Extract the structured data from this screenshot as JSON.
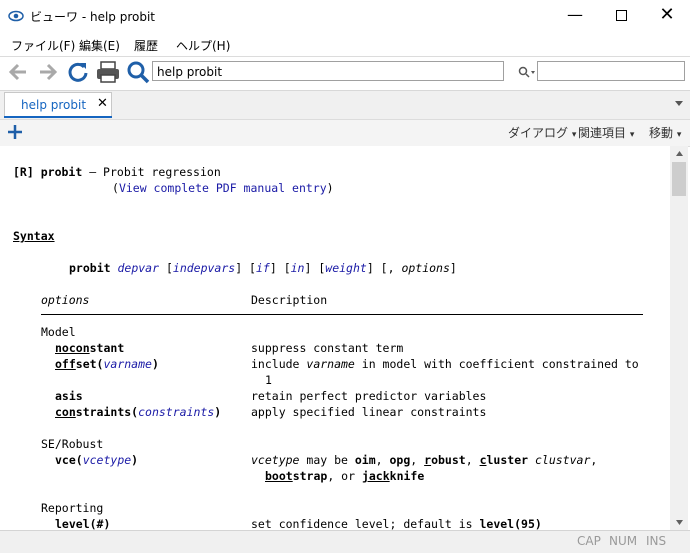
{
  "window": {
    "title": "ビューワ - help probit"
  },
  "menu": {
    "file": "ファイル(F)",
    "edit": "編集(E)",
    "history": "履歴",
    "help": "ヘルプ(H)"
  },
  "toolbar": {
    "address": "help probit",
    "find_placeholder": ""
  },
  "tab": {
    "label": "help probit"
  },
  "subtoolbar": {
    "dialog": "ダイアログ",
    "related": "関連項目",
    "jump": "移動"
  },
  "status": {
    "cap": "CAP",
    "num": "NUM",
    "ins": "INS"
  },
  "help": {
    "ref": "[R]",
    "cmd": "probit",
    "dash": " — ",
    "desc": "Probit regression",
    "pdf_link": "View complete PDF manual entry",
    "syntax_heading": "Syntax",
    "syntax": {
      "cmd": "probit",
      "depvar": "depvar",
      "indepvars": "indepvars",
      "if": "if",
      "in": "in",
      "weight": "weight",
      "options": "options"
    },
    "col_options": "options",
    "col_desc": "Description",
    "groups": {
      "model": "Model",
      "serobust": "SE/Robust",
      "reporting": "Reporting"
    },
    "opts": {
      "noconstant_u": "nocon",
      "noconstant_r": "stant",
      "noconstant_desc": "suppress constant term",
      "offset_u": "off",
      "offset_r": "set(",
      "offset_arg": "varname",
      "offset_close": ")",
      "offset_desc1": "include ",
      "offset_desc_var": "varname",
      "offset_desc2": " in model with coefficient constrained to",
      "offset_desc3": "1",
      "asis": "asis",
      "asis_desc": "retain perfect predictor variables",
      "constraints_u": "con",
      "constraints_r": "straints(",
      "constraints_arg": "constraints",
      "constraints_close": ")",
      "constraints_desc": "apply specified linear constraints",
      "vce": "vce(",
      "vce_arg": "vcetype",
      "vce_close": ")",
      "vce_desc_a": "vcetype",
      "vce_desc_b": " may be ",
      "vce_oim": "oim",
      "vce_opg": "opg",
      "vce_robust_u": "r",
      "vce_robust_r": "obust",
      "vce_cluster_u": "c",
      "vce_cluster_r": "luster",
      "vce_clustervar": "clustvar",
      "vce_boot_u": "boot",
      "vce_boot_r": "strap",
      "vce_or": ", or ",
      "vce_jack_u": "jack",
      "vce_jack_r": "knife",
      "level": "level(#)",
      "level_desc": "set confidence level; default is ",
      "level_default": "level(95)"
    }
  }
}
